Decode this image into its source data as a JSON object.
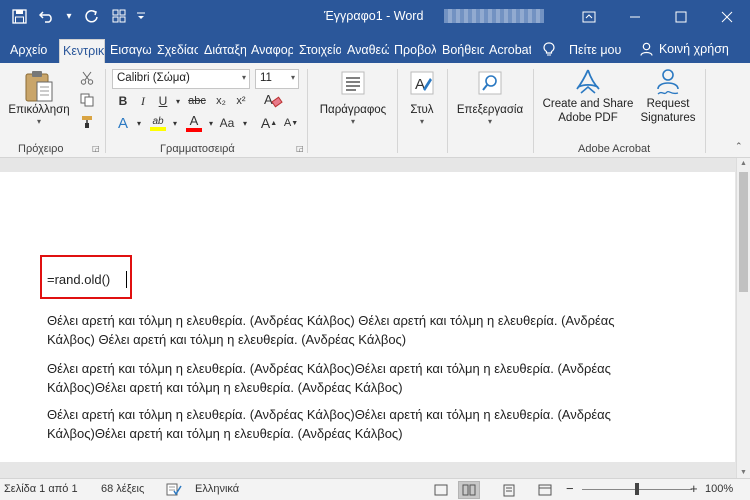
{
  "titlebar": {
    "title": "Έγγραφο1 - Word",
    "icons": {
      "save": "save-icon",
      "undo": "undo-icon",
      "redo": "redo-icon",
      "touch": "touch-mode-icon",
      "customize": "customize-qat-icon"
    },
    "controls": {
      "ribbon_options": "ribbon-display-icon",
      "minimize": "minimize-icon",
      "maximize": "maximize-icon",
      "close": "close-icon"
    }
  },
  "tabs": {
    "items": [
      "Αρχείο",
      "Κεντρική",
      "Εισαγωγή",
      "Σχεδίαση",
      "Διάταξη",
      "Αναφορές",
      "Στοιχεία",
      "Αναθεώρηση",
      "Προβολή",
      "Βοήθεια",
      "Acrobat"
    ],
    "active": "Κεντρική",
    "tell_me": "Πείτε μου",
    "share": "Κοινή χρήση"
  },
  "ribbon": {
    "clipboard": {
      "paste_label": "Επικόλληση",
      "group_label": "Πρόχειρο"
    },
    "font": {
      "font_name": "Calibri (Σώμα)",
      "font_size": "11",
      "group_label": "Γραμματοσειρά",
      "bold": "B",
      "italic": "I",
      "underline": "U",
      "strike": "abc",
      "subscript": "x₂",
      "superscript": "x²",
      "text_effects": "A",
      "highlight": "ab",
      "font_color": "A",
      "change_case": "Aa",
      "grow": "A",
      "shrink": "A",
      "highlight_color": "#ffff00",
      "font_color_hex": "#ff0000"
    },
    "paragraph": {
      "label": "Παράγραφος"
    },
    "styles": {
      "label": "Στυλ"
    },
    "editing": {
      "label": "Επεξεργασία"
    },
    "acrobat": {
      "create_share": "Create and Share Adobe PDF",
      "request_sign": "Request Signatures",
      "group_label": "Adobe Acrobat"
    }
  },
  "document": {
    "formula": "=rand.old()",
    "paragraphs": [
      {
        "line1": "Θέλει αρετή και τόλμη η ελευθερία. (Ανδρέας Κάλβος) Θέλει αρετή και τόλμη η ελευθερία. (Ανδρέας",
        "line2": "Κάλβος) Θέλει αρετή και τόλμη η ελευθερία. (Ανδρέας Κάλβος)"
      },
      {
        "line1": "Θέλει αρετή και τόλμη η ελευθερία. (Ανδρέας Κάλβος)Θέλει αρετή και τόλμη η ελευθερία. (Ανδρέας",
        "line2": "Κάλβος)Θέλει αρετή και τόλμη η ελευθερία. (Ανδρέας Κάλβος)"
      },
      {
        "line1": "Θέλει αρετή και τόλμη η ελευθερία. (Ανδρέας Κάλβος)Θέλει αρετή και τόλμη η ελευθερία. (Ανδρέας",
        "line2": "Κάλβος)Θέλει αρετή και τόλμη η ελευθερία. (Ανδρέας Κάλβος)"
      }
    ],
    "highlight_color": "#e01010"
  },
  "status": {
    "page": "Σελίδα 1 από 1",
    "words": "68 λέξεις",
    "language": "Ελληνικά",
    "zoom_out": "−",
    "zoom_in": "+",
    "zoom": "100%",
    "zoom_level_fraction": 0.5
  }
}
